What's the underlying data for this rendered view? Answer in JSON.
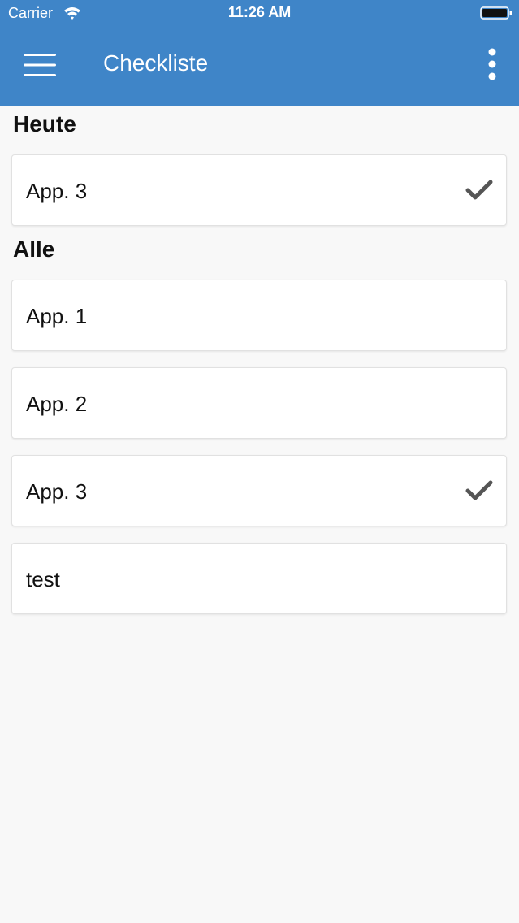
{
  "status_bar": {
    "carrier": "Carrier",
    "time": "11:26 AM"
  },
  "toolbar": {
    "title": "Checkliste",
    "menu_icon": "hamburger-menu-icon",
    "more_icon": "more-vertical-icon"
  },
  "sections": {
    "today": {
      "header": "Heute",
      "items": [
        {
          "label": "App. 3",
          "checked": true
        }
      ]
    },
    "all": {
      "header": "Alle",
      "items": [
        {
          "label": "App. 1",
          "checked": false
        },
        {
          "label": "App. 2",
          "checked": false
        },
        {
          "label": "App. 3",
          "checked": true
        },
        {
          "label": "test",
          "checked": false
        }
      ]
    }
  },
  "colors": {
    "appbar": "#3f85c8",
    "background": "#f8f8f8",
    "checkmark": "#555555"
  }
}
